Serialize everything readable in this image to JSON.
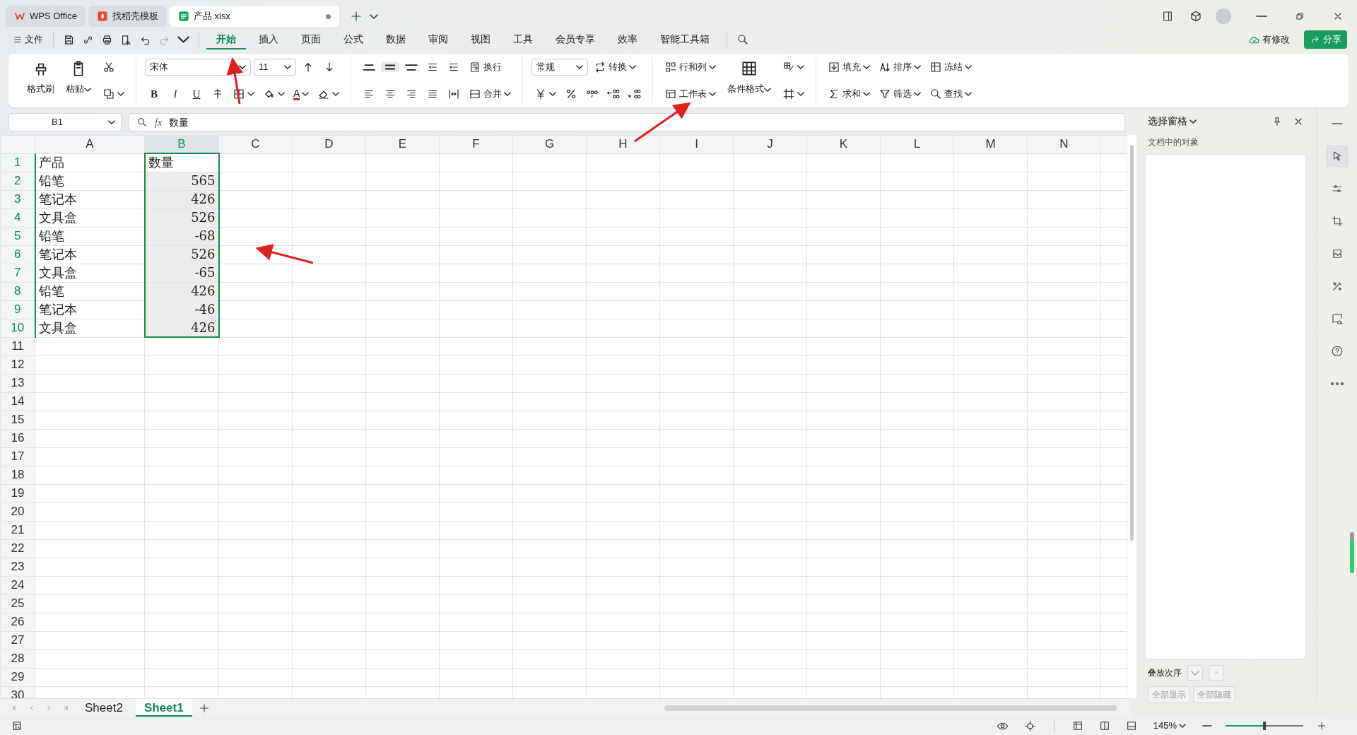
{
  "window_tabs": [
    {
      "label": "WPS Office",
      "kind": "home",
      "selected": false
    },
    {
      "label": "找稻壳模板",
      "kind": "template",
      "selected": false
    },
    {
      "label": "产品.xlsx",
      "kind": "sheet",
      "selected": true
    }
  ],
  "menu": {
    "file": "文件",
    "tabs": [
      {
        "label": "开始",
        "selected": true
      },
      {
        "label": "插入",
        "selected": false
      },
      {
        "label": "页面",
        "selected": false
      },
      {
        "label": "公式",
        "selected": false
      },
      {
        "label": "数据",
        "selected": false
      },
      {
        "label": "审阅",
        "selected": false
      },
      {
        "label": "视图",
        "selected": false
      },
      {
        "label": "工具",
        "selected": false
      },
      {
        "label": "会员专享",
        "selected": false
      },
      {
        "label": "效率",
        "selected": false
      },
      {
        "label": "智能工具箱",
        "selected": false
      }
    ]
  },
  "sync_status": "有修改",
  "share": "分享",
  "ribbon": {
    "format_painter": "格式刷",
    "paste": "粘贴",
    "font_name": "宋体",
    "font_size": "11",
    "bold": "B",
    "italic": "I",
    "underline": "U",
    "font_color": "A",
    "wrap": "换行",
    "merge": "合并",
    "number_format": "常规",
    "convert": "转换",
    "rows_cols": "行和列",
    "worksheet": "工作表",
    "conditional": "条件格式",
    "fill": "填充",
    "sort": "排序",
    "freeze": "冻结",
    "sum": "求和",
    "filter": "筛选",
    "find": "查找"
  },
  "formula_bar": {
    "cell_ref": "B1",
    "fx": "fx",
    "value": "数量"
  },
  "columns": [
    {
      "label": "A",
      "selected": false
    },
    {
      "label": "B",
      "selected": true
    },
    {
      "label": "C",
      "selected": false
    },
    {
      "label": "D",
      "selected": false
    },
    {
      "label": "E",
      "selected": false
    },
    {
      "label": "F",
      "selected": false
    },
    {
      "label": "G",
      "selected": false
    },
    {
      "label": "H",
      "selected": false
    },
    {
      "label": "I",
      "selected": false
    },
    {
      "label": "J",
      "selected": false
    },
    {
      "label": "K",
      "selected": false
    },
    {
      "label": "L",
      "selected": false
    },
    {
      "label": "M",
      "selected": false
    },
    {
      "label": "N",
      "selected": false
    }
  ],
  "rows": [
    {
      "label": "1",
      "selected": true,
      "cells": [
        {
          "text": "产品",
          "kind": "text"
        },
        {
          "text": "数量",
          "kind": "text"
        }
      ]
    },
    {
      "label": "2",
      "selected": true,
      "cells": [
        {
          "text": "铅笔",
          "kind": "text"
        },
        {
          "text": "565",
          "kind": "number"
        }
      ]
    },
    {
      "label": "3",
      "selected": true,
      "cells": [
        {
          "text": "笔记本",
          "kind": "text"
        },
        {
          "text": "426",
          "kind": "number"
        }
      ]
    },
    {
      "label": "4",
      "selected": true,
      "cells": [
        {
          "text": "文具盒",
          "kind": "text"
        },
        {
          "text": "526",
          "kind": "number"
        }
      ]
    },
    {
      "label": "5",
      "selected": true,
      "cells": [
        {
          "text": "铅笔",
          "kind": "text"
        },
        {
          "text": "-68",
          "kind": "number"
        }
      ]
    },
    {
      "label": "6",
      "selected": true,
      "cells": [
        {
          "text": "笔记本",
          "kind": "text"
        },
        {
          "text": "526",
          "kind": "number"
        }
      ]
    },
    {
      "label": "7",
      "selected": true,
      "cells": [
        {
          "text": "文具盒",
          "kind": "text"
        },
        {
          "text": "-65",
          "kind": "number"
        }
      ]
    },
    {
      "label": "8",
      "selected": true,
      "cells": [
        {
          "text": "铅笔",
          "kind": "text"
        },
        {
          "text": "426",
          "kind": "number"
        }
      ]
    },
    {
      "label": "9",
      "selected": true,
      "cells": [
        {
          "text": "笔记本",
          "kind": "text"
        },
        {
          "text": "-46",
          "kind": "number"
        }
      ]
    },
    {
      "label": "10",
      "selected": true,
      "cells": [
        {
          "text": "文具盒",
          "kind": "text"
        },
        {
          "text": "426",
          "kind": "number"
        }
      ]
    },
    {
      "label": "11",
      "selected": false
    },
    {
      "label": "12",
      "selected": false
    },
    {
      "label": "13",
      "selected": false
    },
    {
      "label": "14",
      "selected": false
    },
    {
      "label": "15",
      "selected": false
    },
    {
      "label": "16",
      "selected": false
    },
    {
      "label": "17",
      "selected": false
    },
    {
      "label": "18",
      "selected": false
    },
    {
      "label": "19",
      "selected": false
    },
    {
      "label": "20",
      "selected": false
    },
    {
      "label": "21",
      "selected": false
    },
    {
      "label": "22",
      "selected": false
    },
    {
      "label": "23",
      "selected": false
    },
    {
      "label": "24",
      "selected": false
    },
    {
      "label": "25",
      "selected": false
    },
    {
      "label": "26",
      "selected": false
    },
    {
      "label": "27",
      "selected": false
    },
    {
      "label": "28",
      "selected": false
    },
    {
      "label": "29",
      "selected": false
    },
    {
      "label": "30",
      "selected": false
    }
  ],
  "selection_pane": {
    "title": "选择窗格",
    "subtitle": "文档中的对象",
    "order_label": "叠放次序",
    "buttons": [
      "全部显示",
      "全部隐藏"
    ]
  },
  "sheet_tabs": [
    {
      "label": "Sheet2",
      "selected": false
    },
    {
      "label": "Sheet1",
      "selected": true
    }
  ],
  "status_bar": {
    "zoom": {
      "label": "145%",
      "level": 0.5
    }
  }
}
